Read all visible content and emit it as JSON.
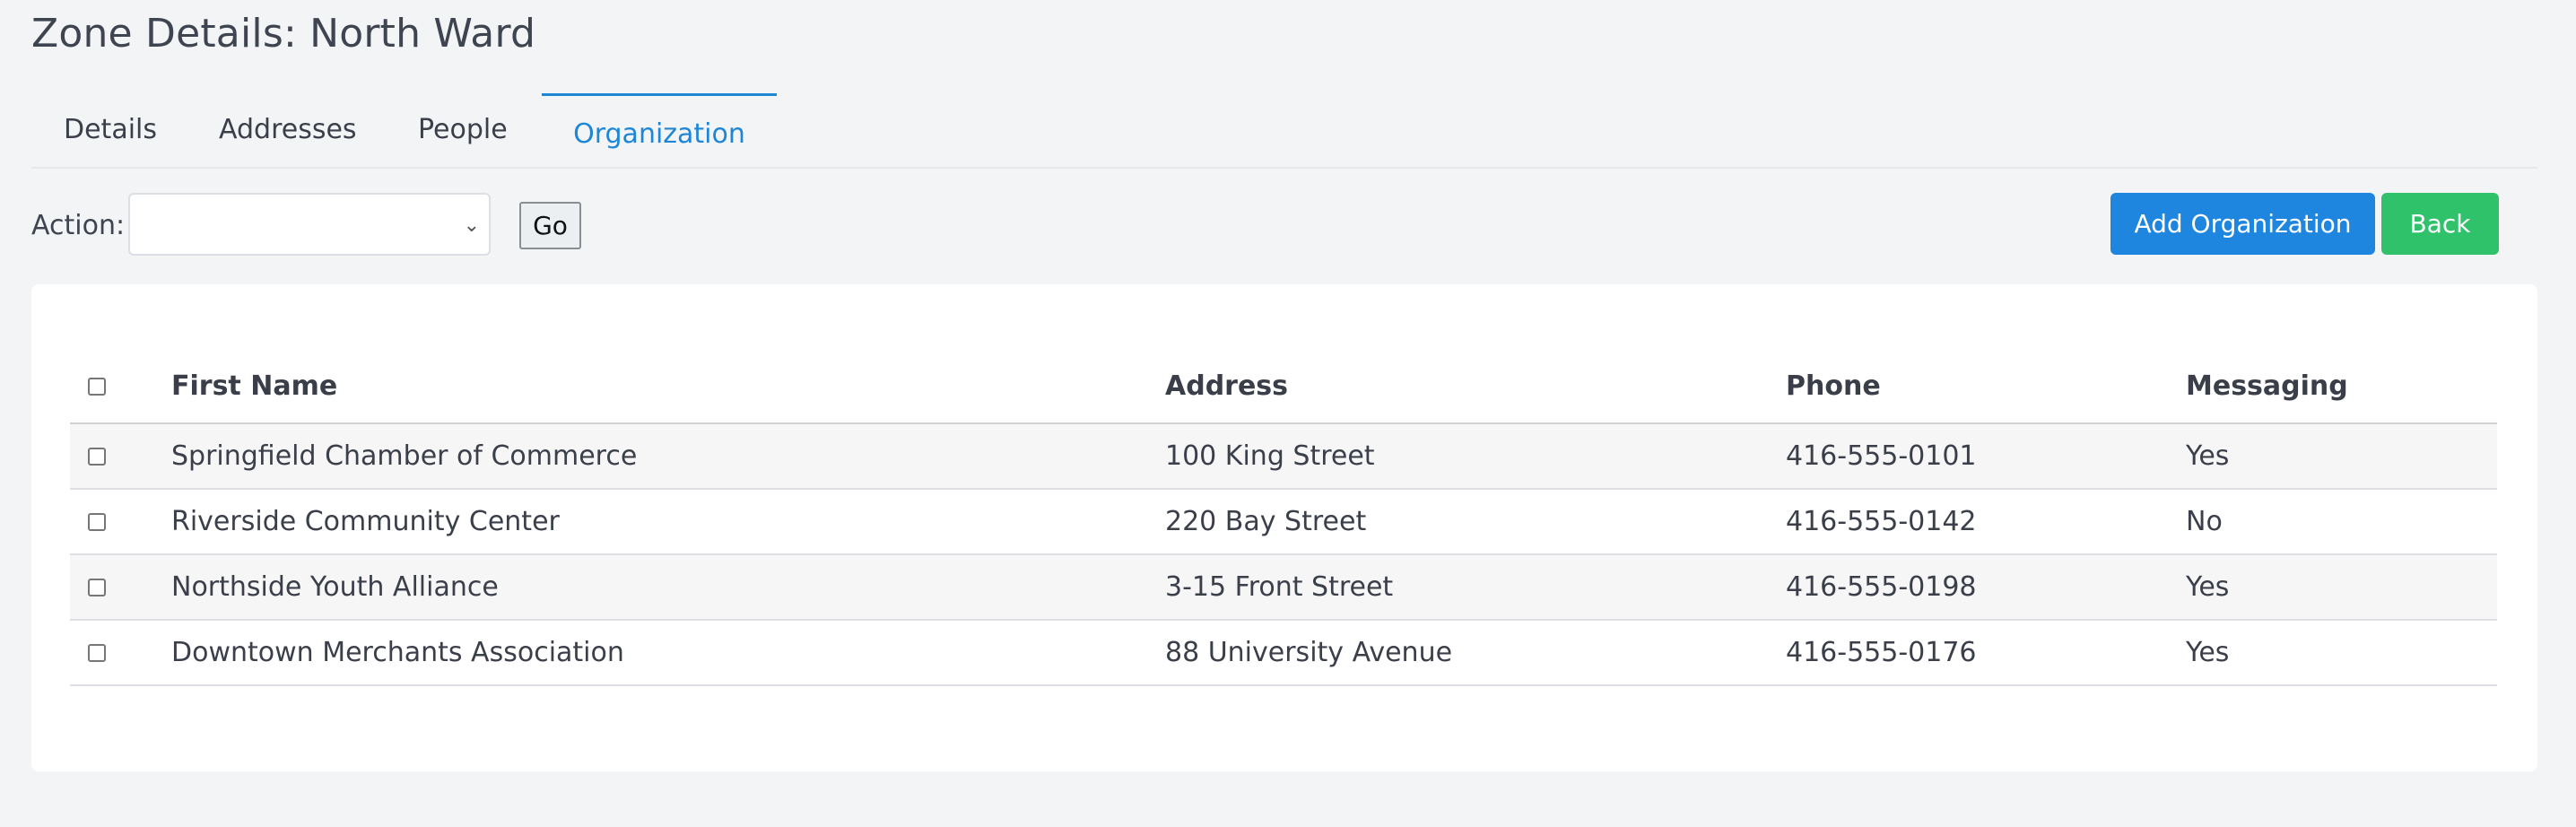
{
  "page": {
    "title": "Zone Details: North Ward"
  },
  "tabs": [
    {
      "label": "Details",
      "active": false
    },
    {
      "label": "Addresses",
      "active": false
    },
    {
      "label": "People",
      "active": false
    },
    {
      "label": "Organization",
      "active": true
    }
  ],
  "toolbar": {
    "action_label": "Action:",
    "action_value": "",
    "go_label": "Go",
    "add_label": "Add Organization",
    "back_label": "Back"
  },
  "table": {
    "columns": [
      "First Name",
      "Address",
      "Phone",
      "Messaging"
    ],
    "rows": [
      {
        "name": "Springfield Chamber of Commerce",
        "address": "100 King Street",
        "phone": "416-555-0101",
        "messaging": "Yes"
      },
      {
        "name": "Riverside Community Center",
        "address": "220 Bay Street",
        "phone": "416-555-0142",
        "messaging": "No"
      },
      {
        "name": "Northside Youth Alliance",
        "address": "3-15 Front Street",
        "phone": "416-555-0198",
        "messaging": "Yes"
      },
      {
        "name": "Downtown Merchants Association",
        "address": "88 University Avenue",
        "phone": "416-555-0176",
        "messaging": "Yes"
      }
    ]
  },
  "icons": {
    "select_chevron": "chevron-down-icon"
  },
  "colors": {
    "accent": "#1f86e0",
    "success": "#2fc26b",
    "active_tab": "#1f86d6",
    "background": "#f3f4f6"
  }
}
